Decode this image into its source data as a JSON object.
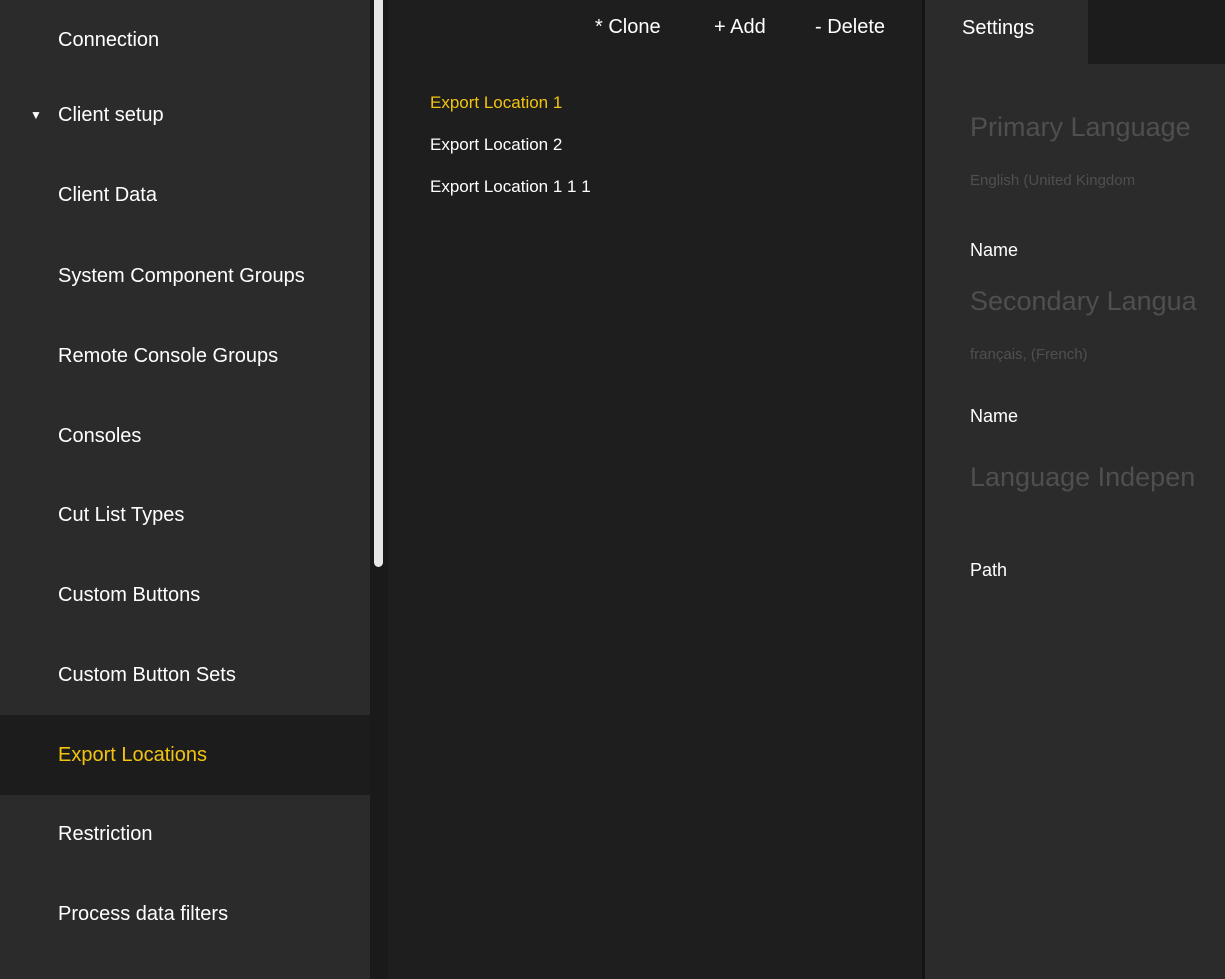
{
  "sidebar": {
    "items": [
      {
        "label": "Connection"
      },
      {
        "label": "Client setup",
        "expanded": true,
        "caret_icon": "triangle-down-icon"
      },
      {
        "label": "Client Data"
      },
      {
        "label": "System Component Groups"
      },
      {
        "label": "Remote Console Groups"
      },
      {
        "label": "Consoles"
      },
      {
        "label": "Cut List Types"
      },
      {
        "label": "Custom Buttons"
      },
      {
        "label": "Custom Button Sets"
      },
      {
        "label": "Export Locations",
        "active": true
      },
      {
        "label": "Restriction"
      },
      {
        "label": "Process data filters"
      }
    ],
    "caret": "▼"
  },
  "toolbar": {
    "clone_label": "* Clone",
    "add_label": "+ Add",
    "delete_label": "- Delete"
  },
  "locations": {
    "items": [
      {
        "label": "Export Location 1",
        "selected": true
      },
      {
        "label": "Export Location 2"
      },
      {
        "label": "Export Location 1 1 1"
      }
    ]
  },
  "settings": {
    "tab_label": "Settings",
    "primary_language_title": "Primary Language",
    "primary_language_value": "English (United Kingdom",
    "primary_name_label": "Name",
    "secondary_language_title": "Secondary Langua",
    "secondary_language_value": "français, (French)",
    "secondary_name_label": "Name",
    "independent_title": "Language Indepen",
    "path_label": "Path"
  },
  "colors": {
    "accent": "#f2c40f",
    "sidebar_bg": "#2b2b2b",
    "list_bg": "#1e1e1e",
    "muted_text": "#4f4f4f"
  }
}
